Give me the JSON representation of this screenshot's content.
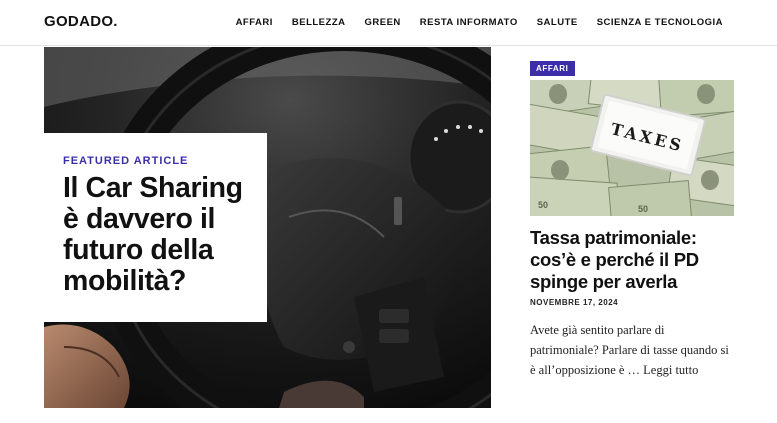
{
  "site": {
    "logo": "GODADO."
  },
  "nav": {
    "items": [
      {
        "label": "AFFARI"
      },
      {
        "label": "BELLEZZA"
      },
      {
        "label": "GREEN"
      },
      {
        "label": "RESTA INFORMATO"
      },
      {
        "label": "SALUTE"
      },
      {
        "label": "SCIENZA E TECNOLOGIA"
      }
    ]
  },
  "featured": {
    "kicker": "FEATURED ARTICLE",
    "title": "Il Car Sharing è davvero il futuro della mobilità?",
    "image_icon": "steering-wheel-photo"
  },
  "sidebar_article": {
    "category": "AFFARI",
    "image_icon": "taxes-money-photo",
    "image_text": "TAXES",
    "title": "Tassa patrimoniale: cos’è e perché il PD spinge per averla",
    "date": "NOVEMBRE 17, 2024",
    "excerpt": "Avete già sentito parlare di patrimoniale? Parlare di tasse quando si è all’opposizione è …",
    "read_more": "Leggi tutto"
  },
  "colors": {
    "accent": "#3b2ea8",
    "text": "#111111",
    "background": "#ffffff"
  }
}
